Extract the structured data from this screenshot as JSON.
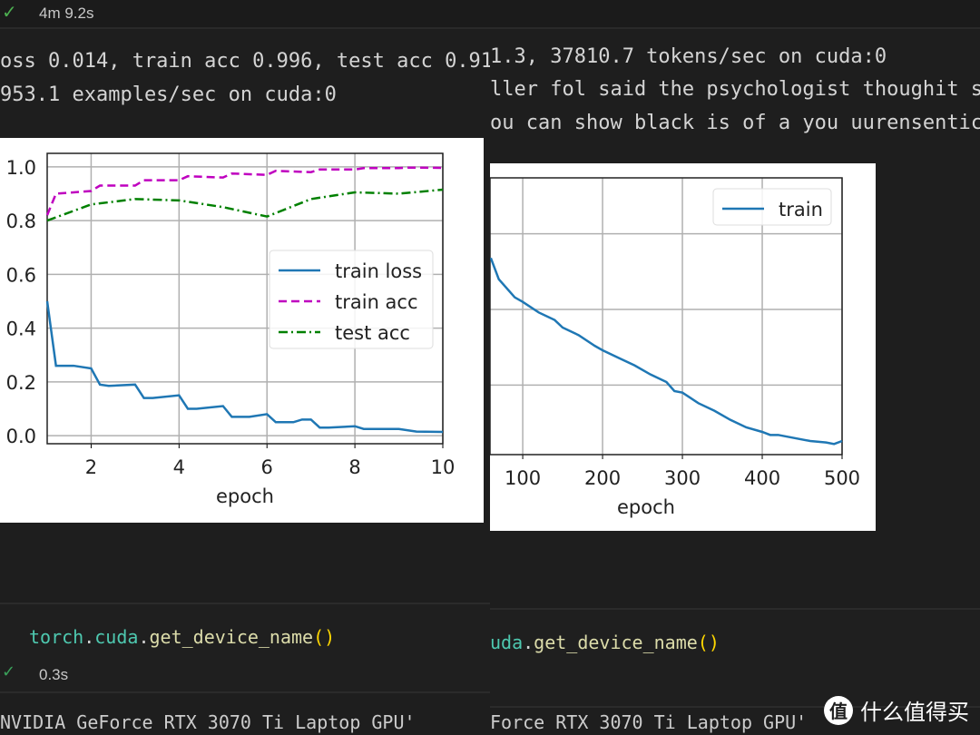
{
  "left": {
    "status": {
      "icon": "check-icon",
      "duration": "4m 9.2s"
    },
    "output_lines": [
      "oss 0.014, train acc 0.996, test acc 0.91",
      "953.1 examples/sec on cuda:0"
    ],
    "code": {
      "module": "torch",
      "attr": "cuda",
      "fn": "get_device_name",
      "parens": "()"
    },
    "code_status": {
      "icon": "check-icon",
      "duration": "0.3s"
    },
    "result": "NVIDIA GeForce RTX 3070 Ti Laptop GPU'"
  },
  "right": {
    "output_lines": [
      "1.3, 37810.7 tokens/sec on cuda:0",
      "ller fol said the psychologist thoughit s a",
      "ou can show black is of a you uurensentice"
    ],
    "code": {
      "attr": "uda",
      "fn": "get_device_name",
      "parens": "()"
    },
    "result": "Force RTX 3070 Ti Laptop GPU'"
  },
  "watermark": {
    "logo": "值",
    "text": "什么值得买"
  },
  "chart_data": [
    {
      "type": "line",
      "xlabel": "epoch",
      "ylabel": "",
      "xlim": [
        1,
        10
      ],
      "ylim": [
        -0.03,
        1.05
      ],
      "xticks": [
        "2",
        "4",
        "6",
        "8",
        "10"
      ],
      "yticks": [
        "0.0",
        "0.2",
        "0.4",
        "0.6",
        "0.8",
        "1.0"
      ],
      "grid": true,
      "legend": "center-right",
      "series": [
        {
          "name": "train loss",
          "color": "#1f77b4",
          "style": "solid",
          "x": [
            1,
            1.2,
            1.6,
            2,
            2.2,
            2.4,
            3,
            3.2,
            3.4,
            4,
            4.2,
            4.4,
            5,
            5.2,
            5.6,
            6,
            6.2,
            6.6,
            6.8,
            7,
            7.2,
            7.4,
            8,
            8.2,
            9,
            9.4,
            10
          ],
          "y": [
            0.5,
            0.26,
            0.26,
            0.25,
            0.19,
            0.185,
            0.19,
            0.14,
            0.14,
            0.15,
            0.1,
            0.1,
            0.11,
            0.07,
            0.07,
            0.08,
            0.05,
            0.05,
            0.06,
            0.06,
            0.03,
            0.03,
            0.035,
            0.025,
            0.025,
            0.015,
            0.014
          ]
        },
        {
          "name": "train acc",
          "color": "#bf00bf",
          "style": "dashed",
          "x": [
            1,
            1.2,
            2,
            2.2,
            3,
            3.2,
            4,
            4.2,
            5,
            5.2,
            6,
            6.2,
            7,
            7.2,
            8,
            8.2,
            9,
            9.2,
            10
          ],
          "y": [
            0.82,
            0.9,
            0.91,
            0.93,
            0.93,
            0.95,
            0.95,
            0.965,
            0.96,
            0.975,
            0.97,
            0.985,
            0.98,
            0.99,
            0.99,
            0.995,
            0.995,
            0.997,
            0.996
          ]
        },
        {
          "name": "test acc",
          "color": "#008000",
          "style": "dashdot",
          "x": [
            1,
            2,
            3,
            4,
            5,
            6,
            7,
            8,
            9,
            10
          ],
          "y": [
            0.8,
            0.86,
            0.88,
            0.875,
            0.85,
            0.815,
            0.88,
            0.905,
            0.9,
            0.915
          ]
        }
      ]
    },
    {
      "type": "line",
      "xlabel": "epoch",
      "ylabel": "",
      "xlim": [
        59,
        500
      ],
      "ylim": [
        0.4,
        18.7
      ],
      "xticks": [
        "100",
        "200",
        "300",
        "400",
        "500"
      ],
      "grid": true,
      "legend": "top-right",
      "series": [
        {
          "name": "train",
          "color": "#1f77b4",
          "style": "solid",
          "x": [
            60,
            70,
            90,
            100,
            120,
            140,
            150,
            170,
            190,
            200,
            220,
            240,
            260,
            280,
            290,
            300,
            320,
            340,
            360,
            380,
            400,
            410,
            420,
            440,
            460,
            480,
            490,
            500
          ],
          "y": [
            13.4,
            12.0,
            10.8,
            10.5,
            9.8,
            9.3,
            8.8,
            8.3,
            7.6,
            7.3,
            6.8,
            6.3,
            5.7,
            5.2,
            4.6,
            4.5,
            3.8,
            3.3,
            2.7,
            2.2,
            1.9,
            1.7,
            1.7,
            1.5,
            1.3,
            1.2,
            1.1,
            1.3
          ]
        }
      ]
    }
  ]
}
